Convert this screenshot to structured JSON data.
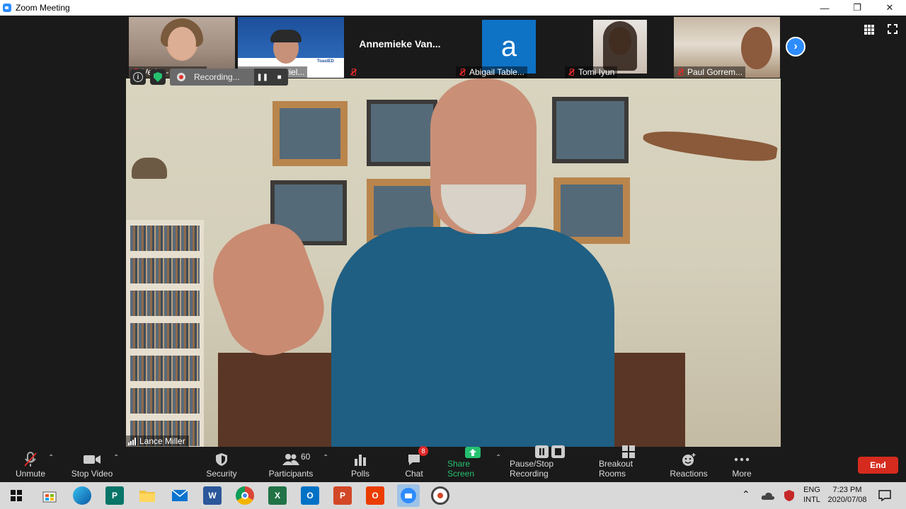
{
  "window": {
    "title": "Zoom Meeting",
    "controls": [
      "—",
      "❐",
      "✕"
    ]
  },
  "participants": [
    {
      "name": "Verity - PRESI..."
    },
    {
      "name": "SAA  Gabriel..."
    },
    {
      "name": "Annemieke  Van..."
    },
    {
      "name": "Abigail Table...",
      "avatar_letter": "a"
    },
    {
      "name": "Tomi Iyun"
    },
    {
      "name": "Paul Gorrem..."
    }
  ],
  "thumb_logo": "ToastED",
  "active_speaker": {
    "name": "Lance Miller"
  },
  "recording": {
    "label": "Recording..."
  },
  "toolbar": {
    "unmute": "Unmute",
    "stop_video": "Stop Video",
    "security": "Security",
    "participants": "Participants",
    "participants_count": "60",
    "polls": "Polls",
    "chat": "Chat",
    "chat_badge": "8",
    "share_screen": "Share Screen",
    "pause_recording": "Pause/Stop Recording",
    "breakout_rooms": "Breakout Rooms",
    "reactions": "Reactions",
    "more": "More",
    "end": "End"
  },
  "taskbar": {
    "apps": [
      "start",
      "store",
      "edge",
      "publisher",
      "file-explorer",
      "mail",
      "word",
      "chrome",
      "excel",
      "outlook",
      "powerpoint",
      "office",
      "zoom",
      "obs"
    ],
    "lang_top": "ENG",
    "lang_bottom": "INTL",
    "time": "7:23 PM",
    "date": "2020/07/08"
  },
  "colors": {
    "accent": "#2d8cff",
    "end": "#d52b1e",
    "share": "#25c16f"
  }
}
